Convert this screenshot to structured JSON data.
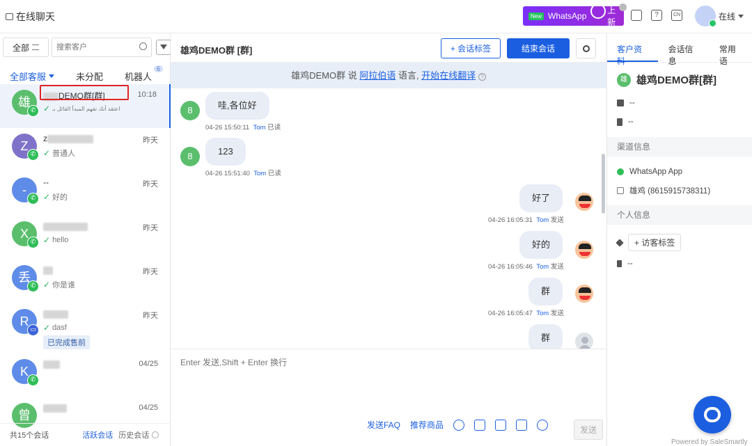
{
  "app": {
    "title": "在线聊天"
  },
  "header": {
    "banner": {
      "badge": "New",
      "text": "WhatsApp",
      "action": "上新"
    },
    "icons": [
      "layout-icon",
      "help-icon",
      "language-cn-icon"
    ],
    "lang_label": "CN",
    "help_label": "?",
    "status": "在线"
  },
  "left": {
    "filter_label": "全部",
    "search_placeholder": "搜索客户",
    "tabs": {
      "all": "全部客服",
      "unassigned": "未分配",
      "bot": "机器人",
      "bot_count": "6"
    },
    "conversations": [
      {
        "avatar": "雄",
        "name": "DEMO群[群]",
        "time": "10:18",
        "preview": "اعتقد أنك تفهم المبدأ القائل بـ",
        "channel": "whatsapp",
        "avatar_color": "#5bbe6d"
      },
      {
        "avatar": "Z",
        "name": "z",
        "time": "昨天",
        "preview": "普通人",
        "channel": "whatsapp",
        "avatar_color": "#7f73c9"
      },
      {
        "avatar": "-",
        "name": "--",
        "time": "昨天",
        "preview": "好的",
        "channel": "whatsapp",
        "avatar_color": "#5e8ce8"
      },
      {
        "avatar": "X",
        "name": "",
        "time": "昨天",
        "preview": "hello",
        "channel": "whatsapp",
        "avatar_color": "#5bbe6d"
      },
      {
        "avatar": "丢",
        "name": "",
        "time": "昨天",
        "preview": "你是谁",
        "channel": "whatsapp",
        "avatar_color": "#5e8ce8"
      },
      {
        "avatar": "R",
        "name": "",
        "time": "昨天",
        "preview": "dasf",
        "channel": "message",
        "avatar_color": "#5e8ce8",
        "tag": "已完成售前"
      },
      {
        "avatar": "K",
        "name": "",
        "time": "04/25",
        "preview": "",
        "channel": "whatsapp",
        "avatar_color": "#5e8ce8"
      },
      {
        "avatar": "曾",
        "name": "",
        "time": "04/25",
        "preview": "",
        "channel": "whatsapp",
        "avatar_color": "#5bbe6d"
      }
    ],
    "footer": {
      "count": "共15个会话",
      "active": "活跃会话",
      "history": "历史会话"
    }
  },
  "chat": {
    "title": "雄鸡DEMO群 [群]",
    "tag_button": "+ 会话标签",
    "end_button": "结束会话",
    "language_notice": {
      "prefix": "雄鸡DEMO群 说",
      "language": "阿拉伯语",
      "middle": "语言,",
      "action": "开始在线翻译"
    },
    "messages": [
      {
        "dir": "in",
        "avatar": "8",
        "text": "哇,各位好",
        "time": "04-26 15:50:11",
        "agent": "Tom",
        "status": "已读"
      },
      {
        "dir": "in",
        "avatar": "8",
        "text": "123",
        "time": "04-26 15:51:40",
        "agent": "Tom",
        "status": "已读"
      },
      {
        "dir": "out",
        "text": "好了",
        "time": "04-26 16:05:31",
        "agent": "Tom",
        "status": "发送"
      },
      {
        "dir": "out",
        "text": "好的",
        "time": "04-26 16:05:46",
        "agent": "Tom",
        "status": "发送"
      },
      {
        "dir": "out",
        "text": "群",
        "time": "04-26 16:05:47",
        "agent": "Tom",
        "status": "发送"
      },
      {
        "dir": "out",
        "text": "群",
        "time": "",
        "agent": "",
        "status": ""
      }
    ],
    "composer_placeholder": "Enter 发送,Shift + Enter 换行",
    "tools": {
      "faq": "发送FAQ",
      "products": "推荐商品"
    },
    "send_button": "发送"
  },
  "right": {
    "tabs": [
      "客户资料",
      "会话信息",
      "常用语"
    ],
    "customer": {
      "avatar": "雄",
      "name": "雄鸡DEMO群[群]",
      "email": "--",
      "phone": "--"
    },
    "channel_section": "渠道信息",
    "channel": {
      "app": "WhatsApp App",
      "account": "雄鸡 (8615915738311)"
    },
    "personal_section": "个人信息",
    "visitor_tag_button": "+ 访客标签",
    "note": "--"
  },
  "footer": {
    "powered": "Powered by SaleSmartly"
  },
  "colors": {
    "primary": "#1b5fe0",
    "whatsapp": "#2fbd58",
    "banner": "#7b2ff7",
    "alert": "#e02525"
  }
}
